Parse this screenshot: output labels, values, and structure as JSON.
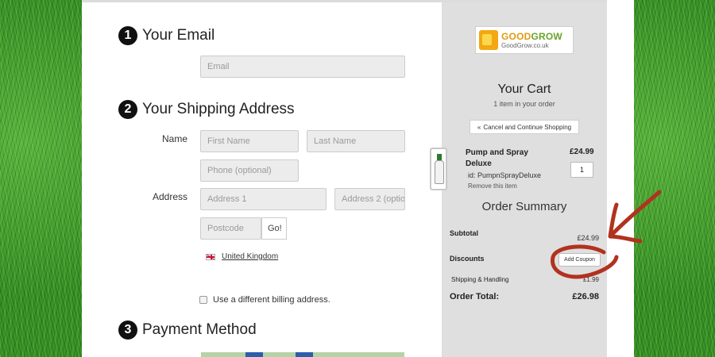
{
  "checkout": {
    "email_section": {
      "number": "1",
      "title": "Your Email",
      "email_placeholder": "Email"
    },
    "shipping_section": {
      "number": "2",
      "title": "Your Shipping Address",
      "name_label": "Name",
      "first_name_placeholder": "First Name",
      "last_name_placeholder": "Last Name",
      "phone_placeholder": "Phone (optional)",
      "address_label": "Address",
      "address1_placeholder": "Address 1",
      "address2_placeholder": "Address 2 (option",
      "postcode_placeholder": "Postcode",
      "go_label": "Go!",
      "country": "United Kingdom",
      "billing_label": "Use a different billing address."
    },
    "payment_section": {
      "number": "3",
      "title": "Payment Method"
    }
  },
  "cart": {
    "logo": {
      "name_part1": "GOOD",
      "name_part2": "GROW",
      "url": "GoodGrow.co.uk"
    },
    "title": "Your Cart",
    "item_count": "1 item in your order",
    "cancel_button": "Cancel and Continue Shopping",
    "cancel_icon": "double-chevron-left-icon",
    "item": {
      "name": "Pump and Spray Deluxe",
      "price": "£24.99",
      "quantity": "1",
      "id_text": "id: PumpnSprayDeluxe",
      "remove_text": "Remove this item"
    },
    "summary": {
      "title": "Order Summary",
      "subtotal_label": "Subtotal",
      "subtotal_value": "£24.99",
      "discounts_label": "Discounts",
      "add_coupon": "Add Coupon",
      "shipping_label": "Shipping & Handling",
      "shipping_value": "£1.99",
      "total_label": "Order Total:",
      "total_value": "£26.98"
    }
  },
  "annotation": {
    "color": "#b2321f"
  }
}
